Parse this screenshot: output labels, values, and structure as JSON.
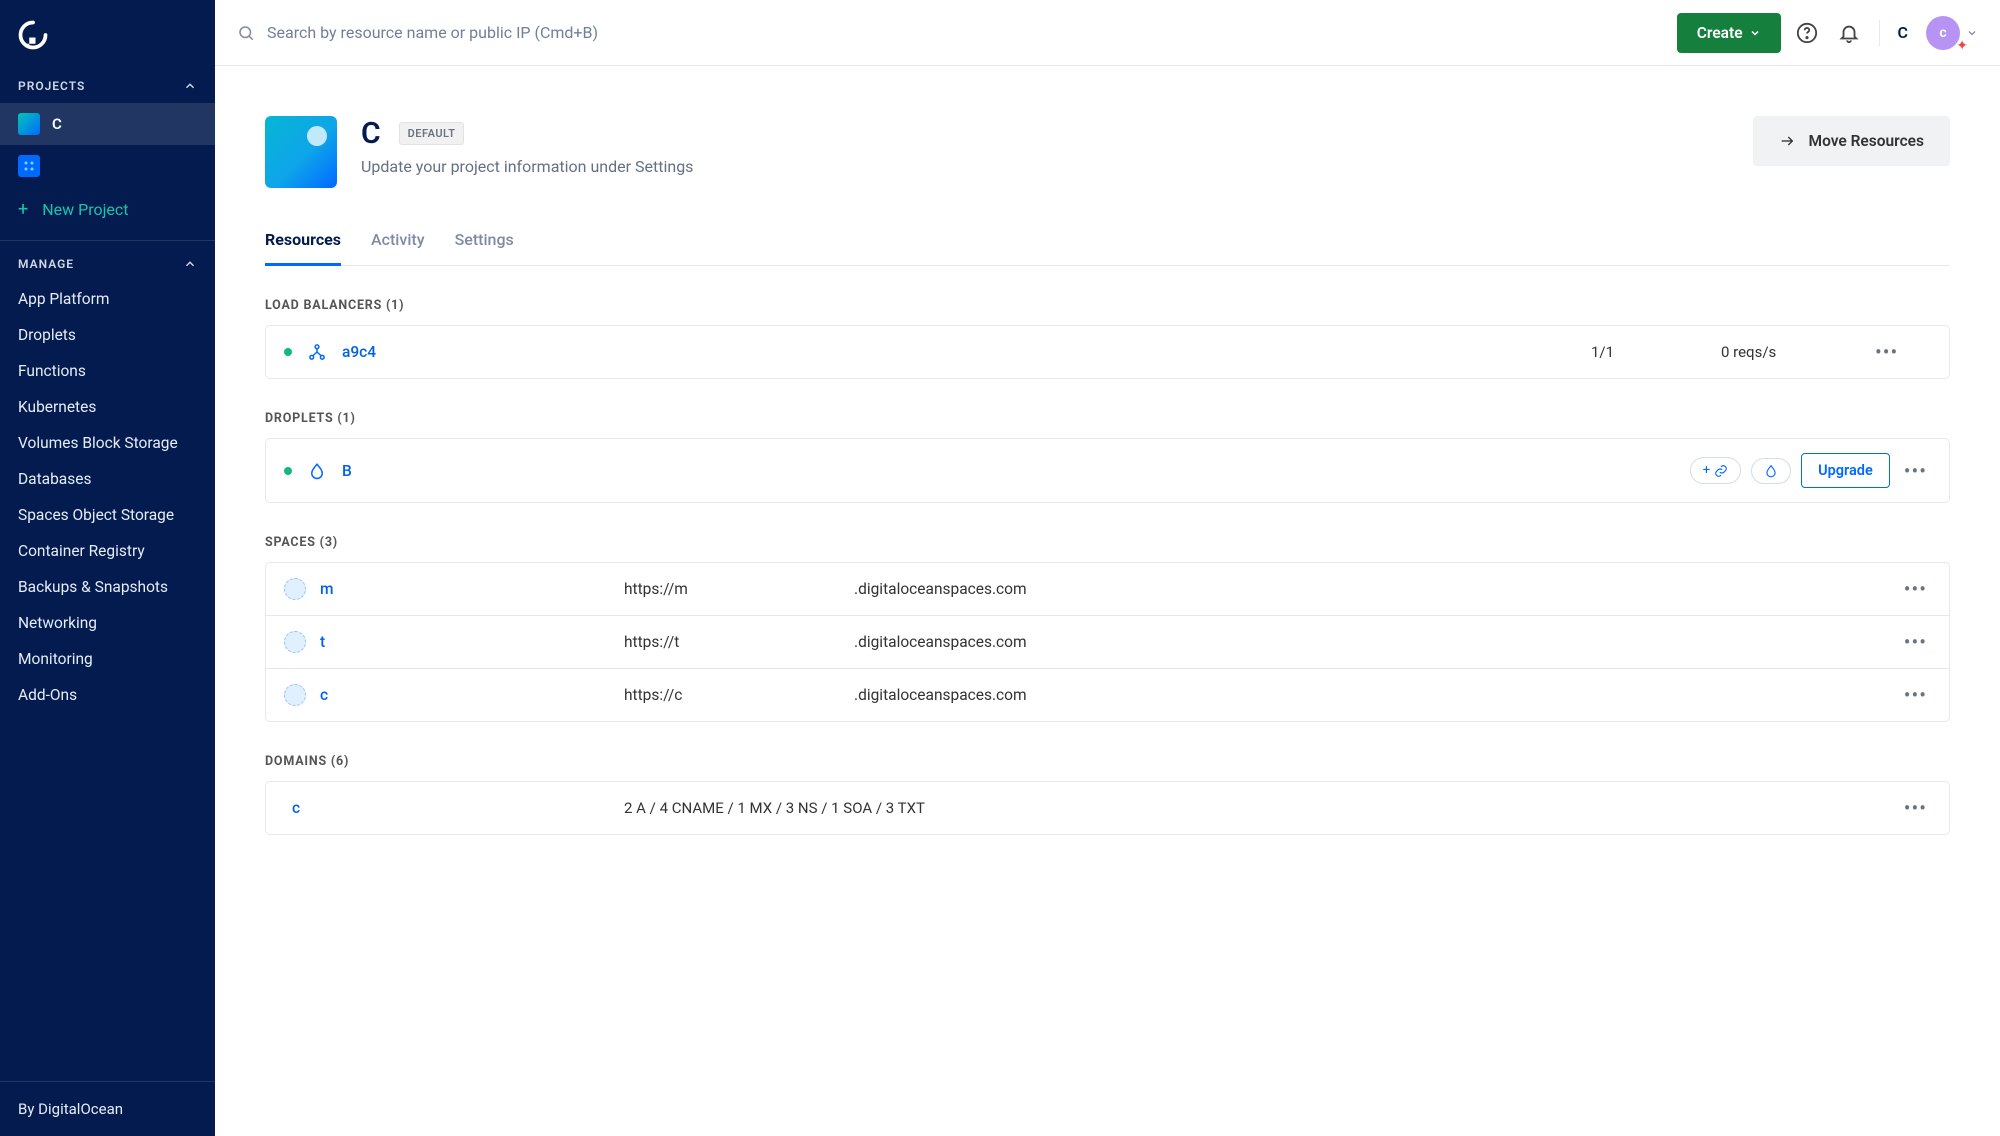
{
  "topbar": {
    "search_placeholder": "Search by resource name or public IP (Cmd+B)",
    "create_label": "Create",
    "account_letter": "C",
    "avatar_letter": "c"
  },
  "sidebar": {
    "projects_header": "PROJECTS",
    "projects": [
      {
        "label": "C"
      }
    ],
    "new_project": "New Project",
    "manage_header": "MANAGE",
    "manage_items": [
      "App Platform",
      "Droplets",
      "Functions",
      "Kubernetes",
      "Volumes Block Storage",
      "Databases",
      "Spaces Object Storage",
      "Container Registry",
      "Backups & Snapshots",
      "Networking",
      "Monitoring",
      "Add-Ons"
    ],
    "footer": "By DigitalOcean"
  },
  "project": {
    "title": "C",
    "default_badge": "DEFAULT",
    "subtitle": "Update your project information under Settings",
    "move_button": "Move Resources"
  },
  "tabs": [
    {
      "label": "Resources",
      "active": true
    },
    {
      "label": "Activity"
    },
    {
      "label": "Settings"
    }
  ],
  "sections": {
    "load_balancers": {
      "header": "LOAD BALANCERS (1)",
      "items": [
        {
          "name": "a9c4",
          "ratio": "1/1",
          "reqs": "0 reqs/s"
        }
      ]
    },
    "droplets": {
      "header": "DROPLETS (1)",
      "items": [
        {
          "name": "B",
          "upgrade": "Upgrade"
        }
      ]
    },
    "spaces": {
      "header": "SPACES (3)",
      "items": [
        {
          "name": "m",
          "prefix": "https://m",
          "domain": ".digitaloceanspaces.com"
        },
        {
          "name": "t",
          "prefix": "https://t",
          "domain": ".digitaloceanspaces.com"
        },
        {
          "name": "c",
          "prefix": "https://c",
          "domain": ".digitaloceanspaces.com"
        }
      ]
    },
    "domains": {
      "header": "DOMAINS (6)",
      "items": [
        {
          "name": "c",
          "records": "2 A / 4 CNAME / 1 MX / 3 NS / 1 SOA / 3 TXT"
        }
      ]
    }
  }
}
